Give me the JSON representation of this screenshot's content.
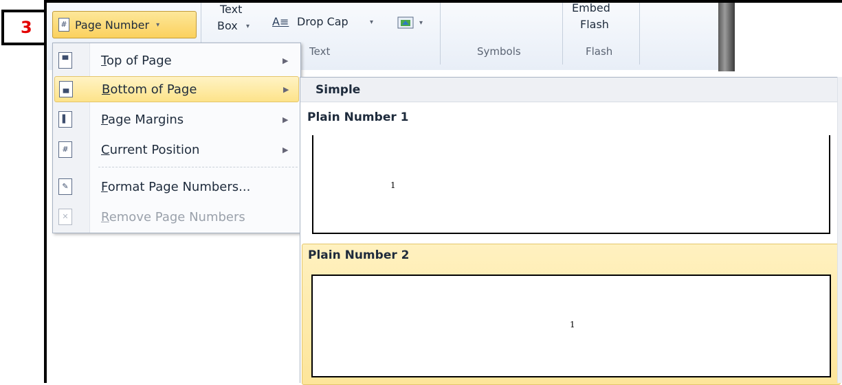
{
  "step_badge": "3",
  "ribbon": {
    "page_number_button": {
      "label": "Page Number",
      "arrow": "▾"
    },
    "text_box": {
      "line1": "Text",
      "line2": "Box",
      "arrow": "▾"
    },
    "drop_cap": {
      "label": "Drop Cap",
      "arrow": "▾"
    },
    "object_arrow": "▾",
    "embed_flash": {
      "line1": "Embed",
      "line2": "Flash"
    },
    "groups": [
      "Text",
      "Symbols",
      "Flash"
    ]
  },
  "menu": {
    "items": [
      {
        "label": "Top of Page",
        "accel": "T",
        "rest": "op of Page",
        "has_submenu": true,
        "highlighted": false,
        "disabled": false,
        "icon": "page-top-icon"
      },
      {
        "label": "Bottom of Page",
        "accel": "B",
        "rest": "ottom of Page",
        "has_submenu": true,
        "highlighted": true,
        "disabled": false,
        "icon": "page-bottom-icon"
      },
      {
        "label": "Page Margins",
        "accel": "P",
        "rest": "age Margins",
        "has_submenu": true,
        "highlighted": false,
        "disabled": false,
        "icon": "page-margins-icon"
      },
      {
        "label": "Current Position",
        "accel": "C",
        "rest": "urrent Position",
        "has_submenu": true,
        "highlighted": false,
        "disabled": false,
        "icon": "current-position-icon"
      },
      {
        "label": "Format Page Numbers...",
        "accel": "F",
        "rest": "ormat Page Numbers...",
        "has_submenu": false,
        "highlighted": false,
        "disabled": false,
        "icon": "format-page-numbers-icon"
      },
      {
        "label": "Remove Page Numbers",
        "accel": "R",
        "rest": "emove Page Numbers",
        "has_submenu": false,
        "highlighted": false,
        "disabled": true,
        "icon": "remove-page-numbers-icon"
      }
    ]
  },
  "gallery": {
    "section_header": "Simple",
    "options": [
      {
        "title": "Plain Number 1",
        "sample": "1",
        "highlighted": false
      },
      {
        "title": "Plain Number 2",
        "sample": "1",
        "highlighted": true
      }
    ]
  },
  "colors": {
    "badge_text": "#e30000",
    "highlight": "#fde38a",
    "highlight_border": "#e4c56a"
  }
}
